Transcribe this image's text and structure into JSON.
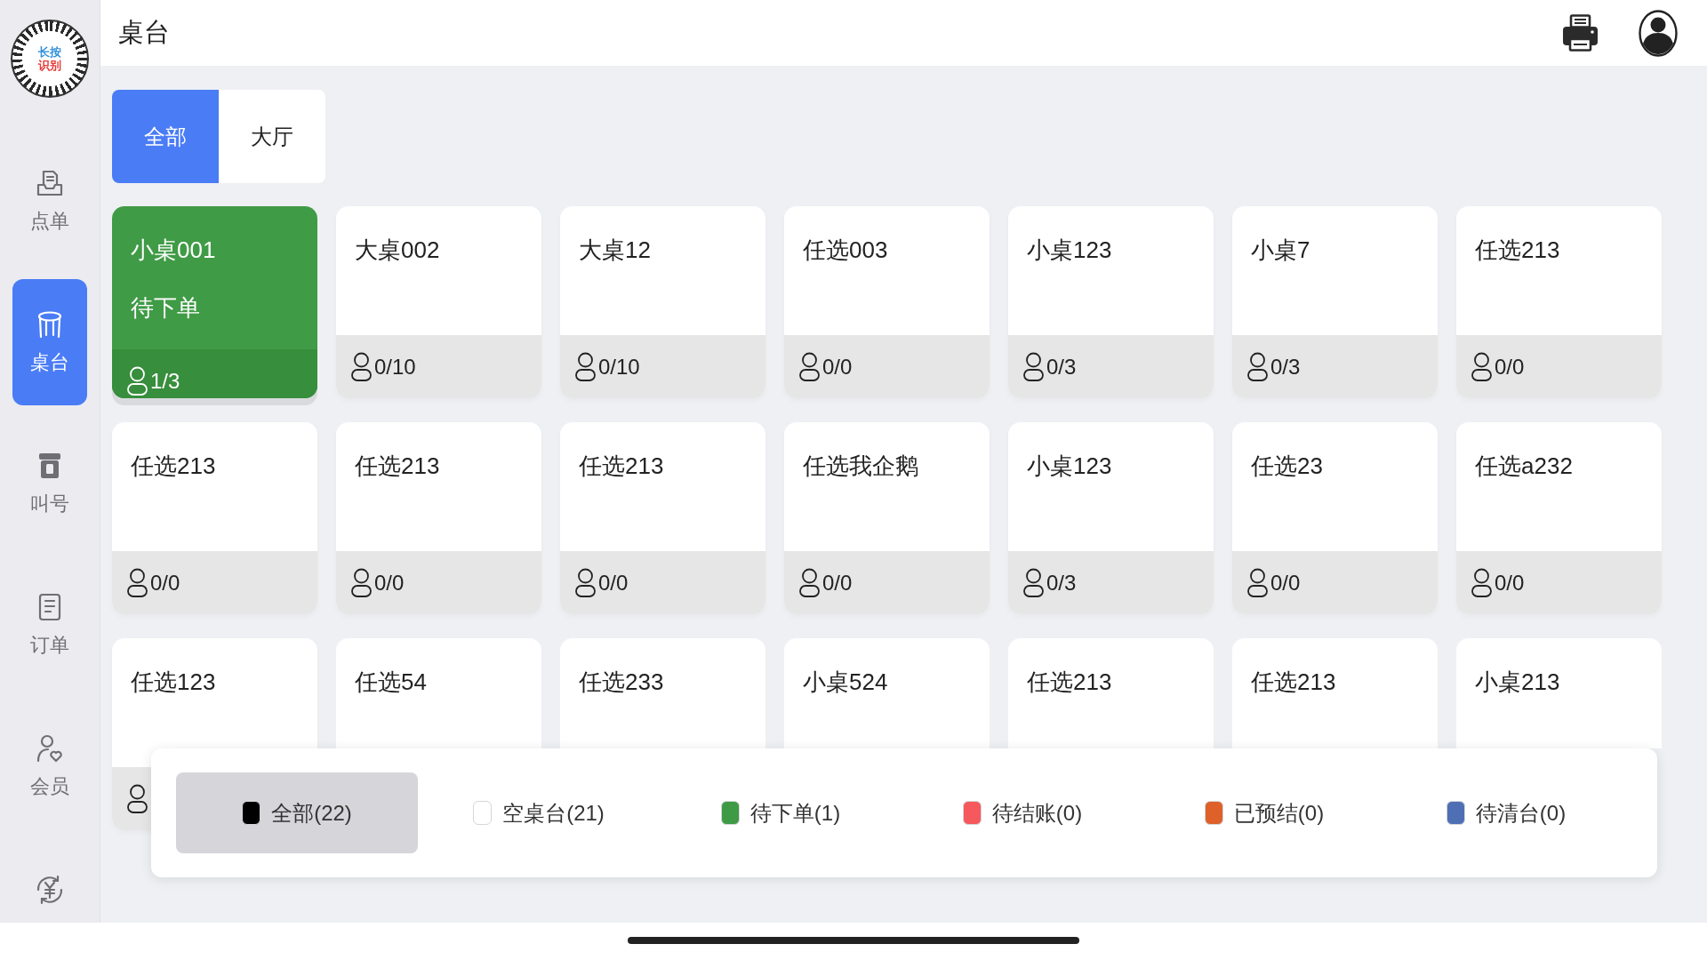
{
  "sidebar": {
    "logo": {
      "lines": [
        "长按",
        "识别"
      ]
    },
    "items": [
      {
        "label": "点单",
        "selected": false
      },
      {
        "label": "桌台",
        "selected": true
      },
      {
        "label": "叫号",
        "selected": false
      },
      {
        "label": "订单",
        "selected": false
      },
      {
        "label": "会员",
        "selected": false
      },
      {
        "selected": false
      }
    ]
  },
  "header": {
    "title": "桌台"
  },
  "area_tabs": [
    {
      "label": "全部",
      "selected": true
    },
    {
      "label": "大厅",
      "selected": false
    }
  ],
  "tables": [
    {
      "name": "小桌001",
      "kind": "pending_order",
      "status_label": "待下单",
      "guests": "1/3"
    },
    {
      "name": "大桌002",
      "kind": "empty",
      "guests": "0/10"
    },
    {
      "name": "大桌12",
      "kind": "empty",
      "guests": "0/10"
    },
    {
      "name": "任选003",
      "kind": "empty",
      "guests": "0/0"
    },
    {
      "name": "小桌123",
      "kind": "empty",
      "guests": "0/3"
    },
    {
      "name": "小桌7",
      "kind": "empty",
      "guests": "0/3"
    },
    {
      "name": "任选213",
      "kind": "empty",
      "guests": "0/0"
    },
    {
      "name": "任选213",
      "kind": "empty",
      "guests": "0/0"
    },
    {
      "name": "任选213",
      "kind": "empty",
      "guests": "0/0"
    },
    {
      "name": "任选213",
      "kind": "empty",
      "guests": "0/0"
    },
    {
      "name": "任选我企鹅",
      "kind": "empty",
      "guests": "0/0"
    },
    {
      "name": "小桌123",
      "kind": "empty",
      "guests": "0/3"
    },
    {
      "name": "任选23",
      "kind": "empty",
      "guests": "0/0"
    },
    {
      "name": "任选a232",
      "kind": "empty",
      "guests": "0/0"
    },
    {
      "name": "任选123",
      "kind": "empty"
    },
    {
      "name": "任选54",
      "kind": "empty"
    },
    {
      "name": "任选233",
      "kind": "empty"
    },
    {
      "name": "小桌524",
      "kind": "empty"
    },
    {
      "name": "任选213",
      "kind": "empty"
    },
    {
      "name": "任选213",
      "kind": "empty"
    },
    {
      "name": "小桌213",
      "kind": "empty"
    }
  ],
  "legend": [
    {
      "label": "全部(22)",
      "color": "#000000",
      "selected": true
    },
    {
      "label": "空桌台(21)",
      "color": "#ffffff",
      "selected": false
    },
    {
      "label": "待下单(1)",
      "color": "#3f9a45",
      "selected": false
    },
    {
      "label": "待结账(0)",
      "color": "#f5595c",
      "selected": false
    },
    {
      "label": "已预结(0)",
      "color": "#dd6128",
      "selected": false
    },
    {
      "label": "待清台(0)",
      "color": "#4f6fb5",
      "selected": false
    }
  ]
}
